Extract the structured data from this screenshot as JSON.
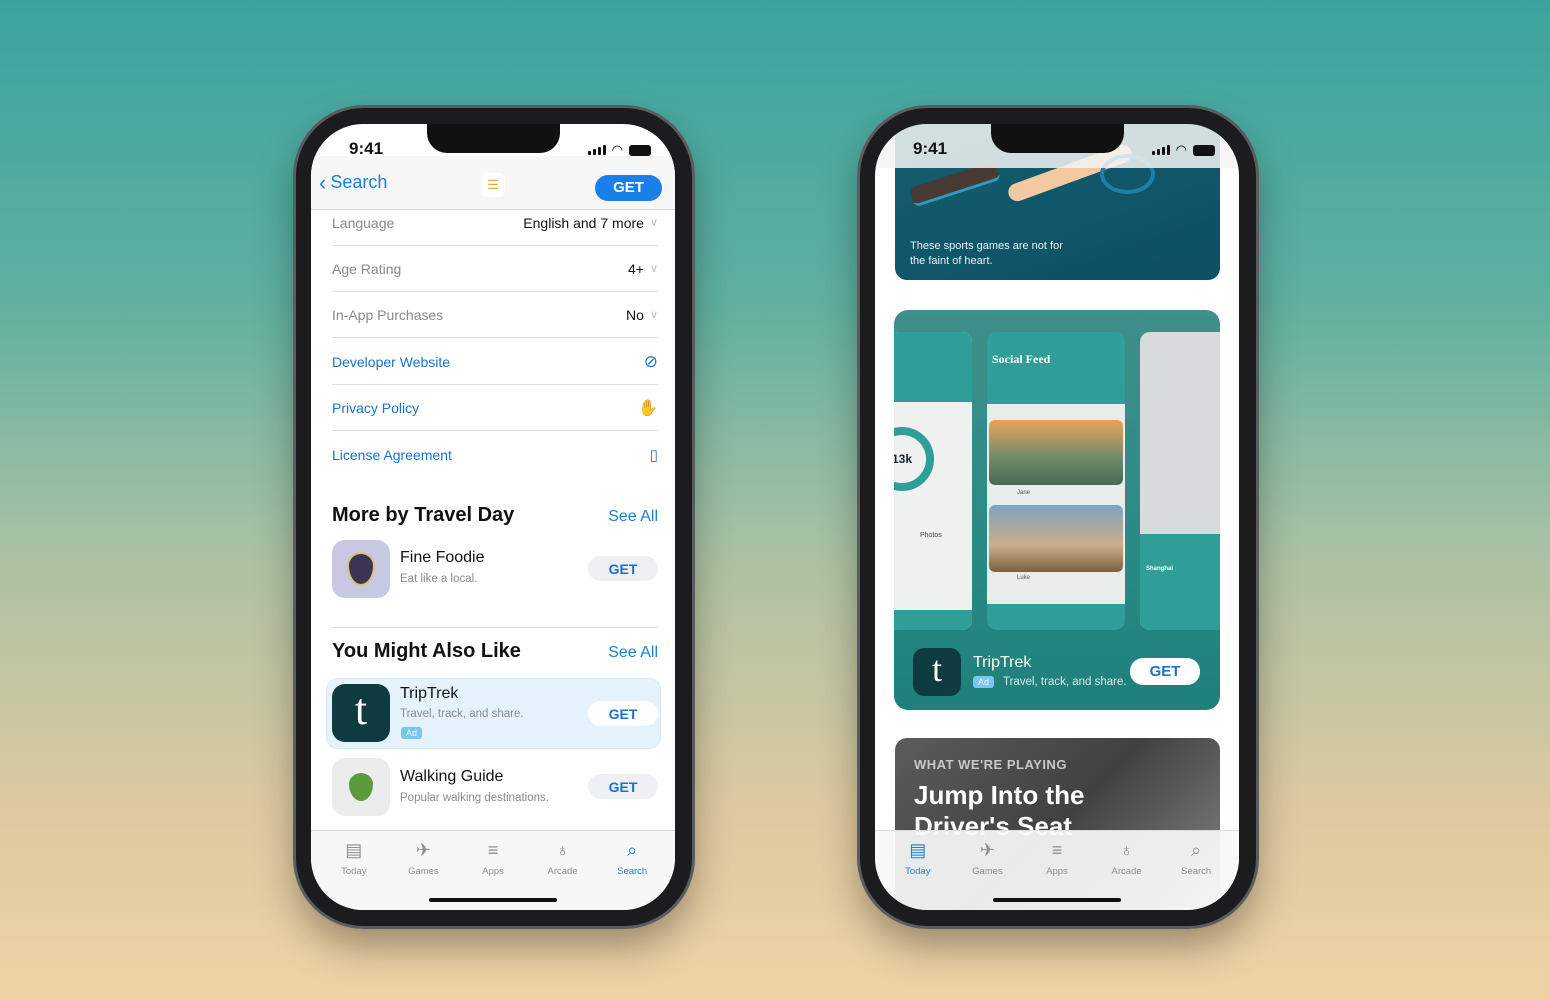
{
  "status": {
    "time": "9:41"
  },
  "left_phone": {
    "nav": {
      "back_label": "Search",
      "get_label": "GET",
      "app_icon": "checklist-icon"
    },
    "info_rows": [
      {
        "label": "Language",
        "value": "English and 7 more"
      },
      {
        "label": "Age Rating",
        "value": "4+"
      },
      {
        "label": "In-App Purchases",
        "value": "No"
      }
    ],
    "links": [
      {
        "label": "Developer Website",
        "icon": "compass-icon"
      },
      {
        "label": "Privacy Policy",
        "icon": "hand-icon"
      },
      {
        "label": "License Agreement",
        "icon": "document-icon"
      }
    ],
    "more_by": {
      "title": "More by Travel Day",
      "see_all": "See All",
      "apps": [
        {
          "name": "Fine Foodie",
          "subtitle": "Eat like a local.",
          "get": "GET"
        }
      ]
    },
    "might_like": {
      "title": "You Might Also Like",
      "see_all": "See All",
      "apps": [
        {
          "name": "TripTrek",
          "subtitle": "Travel, track, and share.",
          "badge": "Ad",
          "get": "GET",
          "icon_letter": "t"
        },
        {
          "name": "Walking Guide",
          "subtitle": "Popular walking destinations.",
          "get": "GET"
        }
      ]
    },
    "tabs": [
      {
        "label": "Today",
        "icon": "today-icon"
      },
      {
        "label": "Games",
        "icon": "rocket-icon"
      },
      {
        "label": "Apps",
        "icon": "layers-icon"
      },
      {
        "label": "Arcade",
        "icon": "joystick-icon"
      },
      {
        "label": "Search",
        "icon": "search-icon"
      }
    ],
    "active_tab": "Search"
  },
  "right_phone": {
    "sports_card": {
      "text1": "These sports games are not for",
      "text2": "the faint of heart."
    },
    "ad_card": {
      "screens": {
        "feed_title": "Social Feed",
        "stat": "13k",
        "photos": "Photos",
        "user1": "Jane",
        "user2": "Luke",
        "city": "Shanghai"
      },
      "app": {
        "name": "TripTrek",
        "badge": "Ad",
        "subtitle": "Travel, track, and share.",
        "get": "GET",
        "icon_letter": "t"
      }
    },
    "story_card": {
      "eyebrow": "WHAT WE'RE PLAYING",
      "title1": "Jump Into the",
      "title2": "Driver's Seat"
    },
    "tabs": [
      {
        "label": "Today"
      },
      {
        "label": "Games"
      },
      {
        "label": "Apps"
      },
      {
        "label": "Arcade"
      },
      {
        "label": "Search"
      }
    ],
    "active_tab": "Today"
  },
  "colors": {
    "accent": "#1a7fd6",
    "teal": "#2f9e98",
    "dark_teal": "#0e4d5e"
  }
}
